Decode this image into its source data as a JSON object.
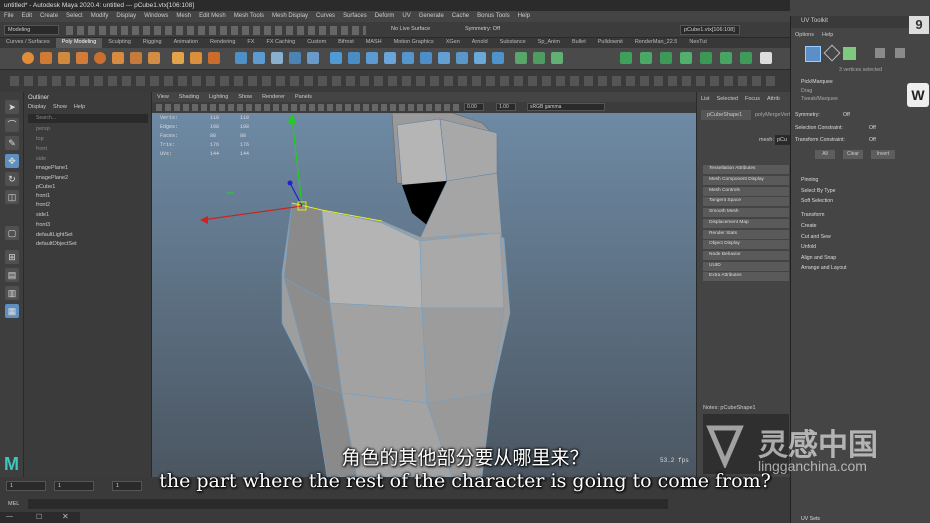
{
  "window": {
    "title": "untitled* - Autodesk Maya 2020.4: untitled   ---   pCube1.vtx[106:108]"
  },
  "menu": [
    "File",
    "Edit",
    "Create",
    "Select",
    "Modify",
    "Display",
    "Windows",
    "Mesh",
    "Edit Mesh",
    "Mesh Tools",
    "Mesh Display",
    "Curves",
    "Surfaces",
    "Deform",
    "UV",
    "Generate",
    "Cache",
    "Bonus Tools",
    "Help"
  ],
  "status": {
    "mode": "Modeling",
    "live": "No Live Surface",
    "symmetry": "Symmetry: Off",
    "selection": "pCube1.vtx[106:108]"
  },
  "shelf_tabs": [
    "Curves / Surfaces",
    "Poly Modeling",
    "Sculpting",
    "Rigging",
    "Animation",
    "Rendering",
    "FX",
    "FX Caching",
    "Custom",
    "Bifrost",
    "MASH",
    "Motion Graphics",
    "XGen",
    "Arnold",
    "Substance",
    "Sp_Anim",
    "Bullet",
    "Pulldownit",
    "RenderMan_22.5",
    "NexTut"
  ],
  "outliner": {
    "title": "Outliner",
    "menu": [
      "Display",
      "Show",
      "Help"
    ],
    "search": "Search...",
    "items": [
      "persp",
      "top",
      "front",
      "side",
      "imagePlane1",
      "imagePlane2",
      "pCube1",
      "front1",
      "front2",
      "side1",
      "front3",
      "defaultLightSet",
      "defaultObjectSet"
    ]
  },
  "viewport": {
    "menu": [
      "View",
      "Shading",
      "Lighting",
      "Show",
      "Renderer",
      "Panels"
    ],
    "field1": "0.00",
    "field2": "1.00",
    "colorspace": "sRGB gamma",
    "hud_rows": [
      [
        "Verts:",
        "110",
        "110",
        "0"
      ],
      [
        "Edges:",
        "108",
        "108",
        "0"
      ],
      [
        "Faces:",
        "88",
        "88",
        "0"
      ],
      [
        "Tris:",
        "176",
        "176",
        "0"
      ],
      [
        "UVs:",
        "144",
        "144",
        "0"
      ]
    ],
    "fps": "53.2 fps"
  },
  "attr_editor": {
    "tabs": [
      "List",
      "Selected",
      "Focus",
      "Attrib"
    ],
    "node_tab": "pCubeShape1",
    "node_tab2": "polyMergeVert",
    "mesh_label": "mesh:",
    "mesh_value": "pCu",
    "sections": [
      "Tessellation Attributes",
      "Mesh Component Display",
      "Mesh Controls",
      "Tangent Space",
      "Smooth Mesh",
      "Displacement Map",
      "Render Stats",
      "Object Display",
      "Node Behavior",
      "UUID",
      "Extra Attributes"
    ],
    "notes": "Notes: pCubeShape1"
  },
  "uv_toolkit": {
    "title": "UV Toolkit",
    "menu": [
      "Options",
      "Help"
    ],
    "selected": "3 vertices selected",
    "modes": [
      "Pick/Marquee",
      "Drag",
      "Tweak/Marquee"
    ],
    "symmetry_label": "Symmetry:",
    "symmetry_val": "Off",
    "constraint1_label": "Selection Constraint:",
    "constraint1_val": "Off",
    "constraint2_label": "Transform Constraint:",
    "constraint2_val": "Off",
    "buttons": [
      "All",
      "Clear",
      "Invert"
    ],
    "sections": [
      "Pinning",
      "Select By Type",
      "Soft Selection",
      "Transform",
      "Create",
      "Cut and Sew",
      "Unfold",
      "Align and Snap",
      "Arrange and Layout"
    ],
    "footer": "UV Sets"
  },
  "bottom": {
    "frame1": "1",
    "frame2": "1",
    "frame3": "1",
    "mel": "MEL"
  },
  "subtitle": {
    "cn": "角色的其他部分要从哪里来？",
    "en": "the part where the rest of the character is going to come from?"
  },
  "watermark": {
    "cn": "灵感中国",
    "url": "lingganchina.com",
    "badge": "9"
  }
}
